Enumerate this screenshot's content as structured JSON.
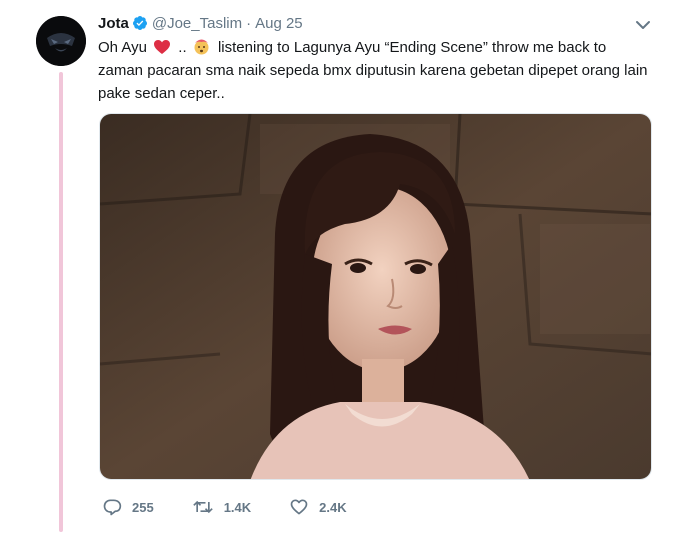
{
  "author": {
    "name": "Jota",
    "handle": "@Joe_Taslim",
    "separator": "·",
    "date": "Aug 25"
  },
  "tweet": {
    "text_part1": "Oh Ayu",
    "text_part2": "..",
    "text_part3": "listening to Lagunya Ayu “Ending Scene” throw me back to zaman pacaran sma naik sepeda bmx diputusin karena gebetan dipepet orang lain pake sedan ceper.."
  },
  "icons": {
    "verified": "verified-badge-icon",
    "caret": "chevron-down-icon",
    "heart_emoji": "red-heart-emoji",
    "face_emoji": "exploding-head-emoji",
    "reply": "reply-icon",
    "retweet": "retweet-icon",
    "like": "like-heart-icon"
  },
  "actions": {
    "replies": "255",
    "retweets": "1.4K",
    "likes": "2.4K"
  },
  "colors": {
    "text": "#14171a",
    "muted": "#657786",
    "verified": "#1da1f2",
    "thread_line": "#f1c6d9",
    "heart_emoji": "#dd2e44"
  }
}
